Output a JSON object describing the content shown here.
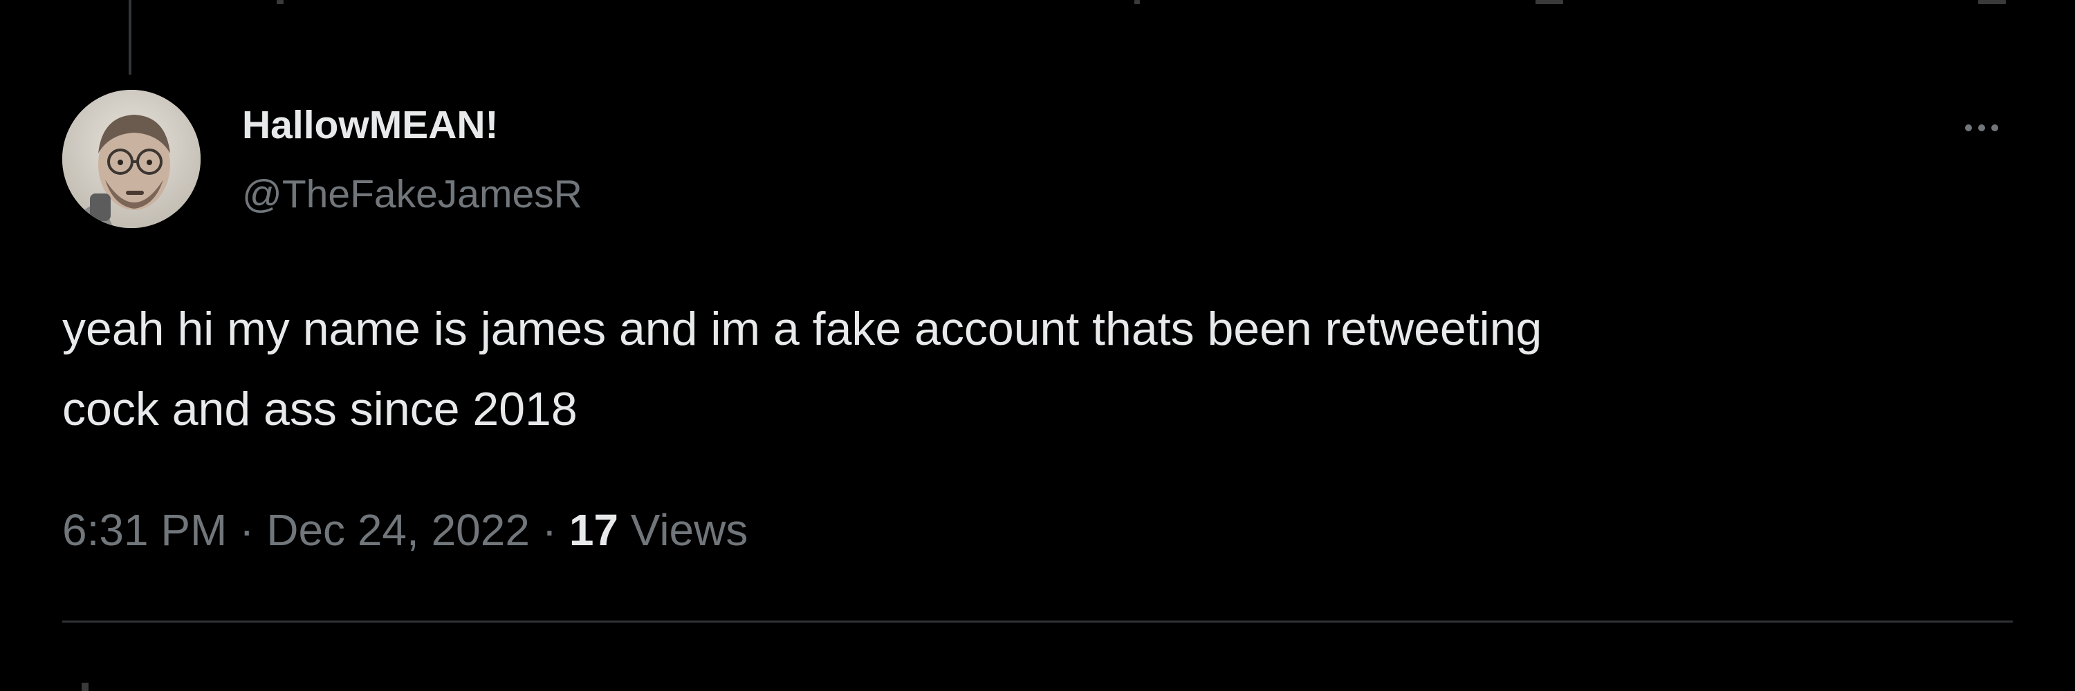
{
  "tweet": {
    "display_name": "HallowMEAN!",
    "handle": "@TheFakeJamesR",
    "text_lines": [
      "yeah hi my name is james and im a fake account thats been retweeting",
      "cock and ass since 2018"
    ],
    "time": "6:31 PM",
    "separator": "·",
    "date": "Dec 24, 2022",
    "views_count": "17",
    "views_label": "Views"
  },
  "icons": {
    "more": "more-horizontal-icon",
    "avatar": "profile-photo"
  },
  "colors": {
    "background": "#000000",
    "primary_text": "#e7e9ea",
    "secondary_text": "#71767b",
    "divider": "#2f3336"
  }
}
